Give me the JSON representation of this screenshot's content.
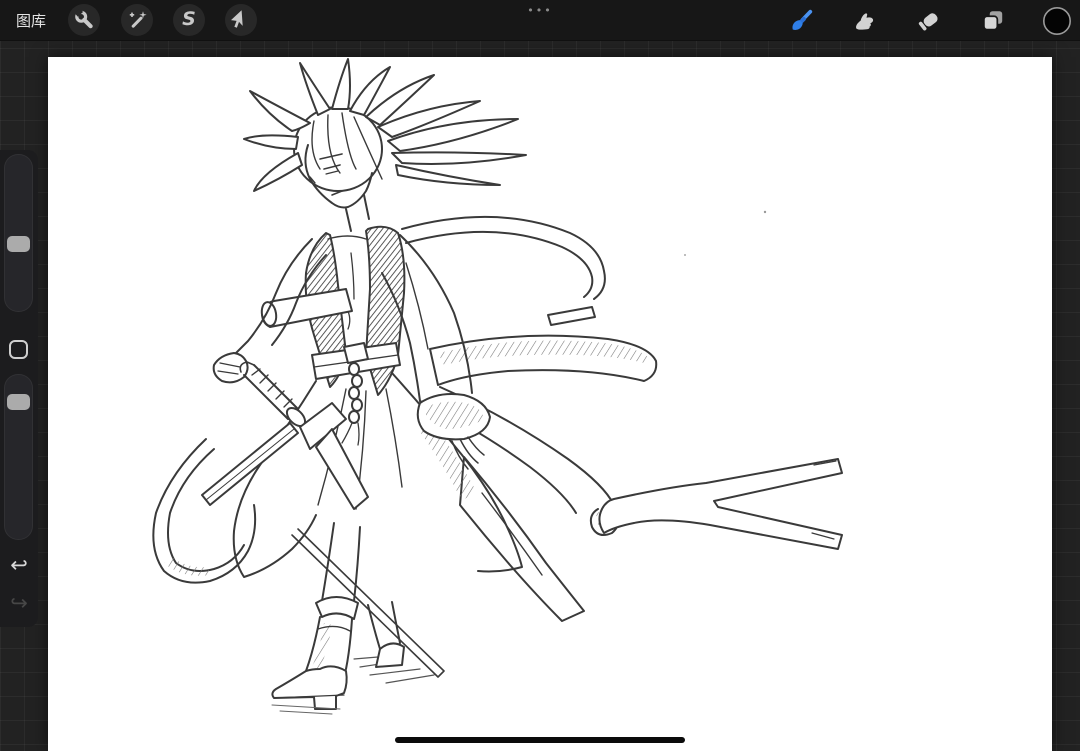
{
  "topbar": {
    "gallery_label": "图库",
    "system_dots": "•••",
    "left_tools": [
      {
        "id": "actions",
        "icon": "wrench-icon"
      },
      {
        "id": "adjustments",
        "icon": "magic-wand-icon"
      },
      {
        "id": "selection",
        "icon": "selection-s-icon",
        "glyph": "S"
      },
      {
        "id": "transform",
        "icon": "transform-arrow-icon"
      }
    ],
    "right_tools": [
      {
        "id": "paint",
        "icon": "paintbrush-icon",
        "active": true
      },
      {
        "id": "smudge",
        "icon": "smudge-finger-icon",
        "active": false
      },
      {
        "id": "erase",
        "icon": "eraser-icon",
        "active": false
      },
      {
        "id": "layers",
        "icon": "layers-icon",
        "active": false
      },
      {
        "id": "color",
        "icon": "color-swatch-circle",
        "active": false,
        "swatch_color": "#000000"
      }
    ]
  },
  "sidebar": {
    "size_slider": {
      "thumb_position_percent_from_top": 58
    },
    "opacity_slider": {
      "thumb_position_percent_from_top": 11
    },
    "modify_button": {
      "shape": "rounded-square-outline"
    },
    "undo_glyph": "↩",
    "redo_glyph": "↪"
  },
  "canvas": {
    "background_color": "#ffffff",
    "artwork_description": "Black pencil line-art sketch of a samurai figure with wild spiky ponytail hair, open dark vest, one arm extended holding a katana pointing down-left, flowing wide sleeve, obi sash with braided cord, long ribbons and a scabbard streaming to the right ending in forked tails, wide hakama pants, knee-high heeled boots, thin scabbard pole and hatched ground shadow"
  },
  "colors": {
    "topbar_bg": "#171717",
    "workspace_bg": "#222222",
    "grid_line": "#2d2d2d",
    "icon_default": "#cccccc",
    "icon_active_blue": "#2f7fe8",
    "button_circle_bg": "#282828",
    "sidebar_bg": "#1c1c1e",
    "slider_track": "#26262a",
    "slider_thumb": "#ababab",
    "color_swatch": "#000000",
    "home_indicator": "#0b0b0b",
    "canvas_bg": "#ffffff"
  },
  "home_indicator": {
    "shape": "rounded-bar"
  }
}
